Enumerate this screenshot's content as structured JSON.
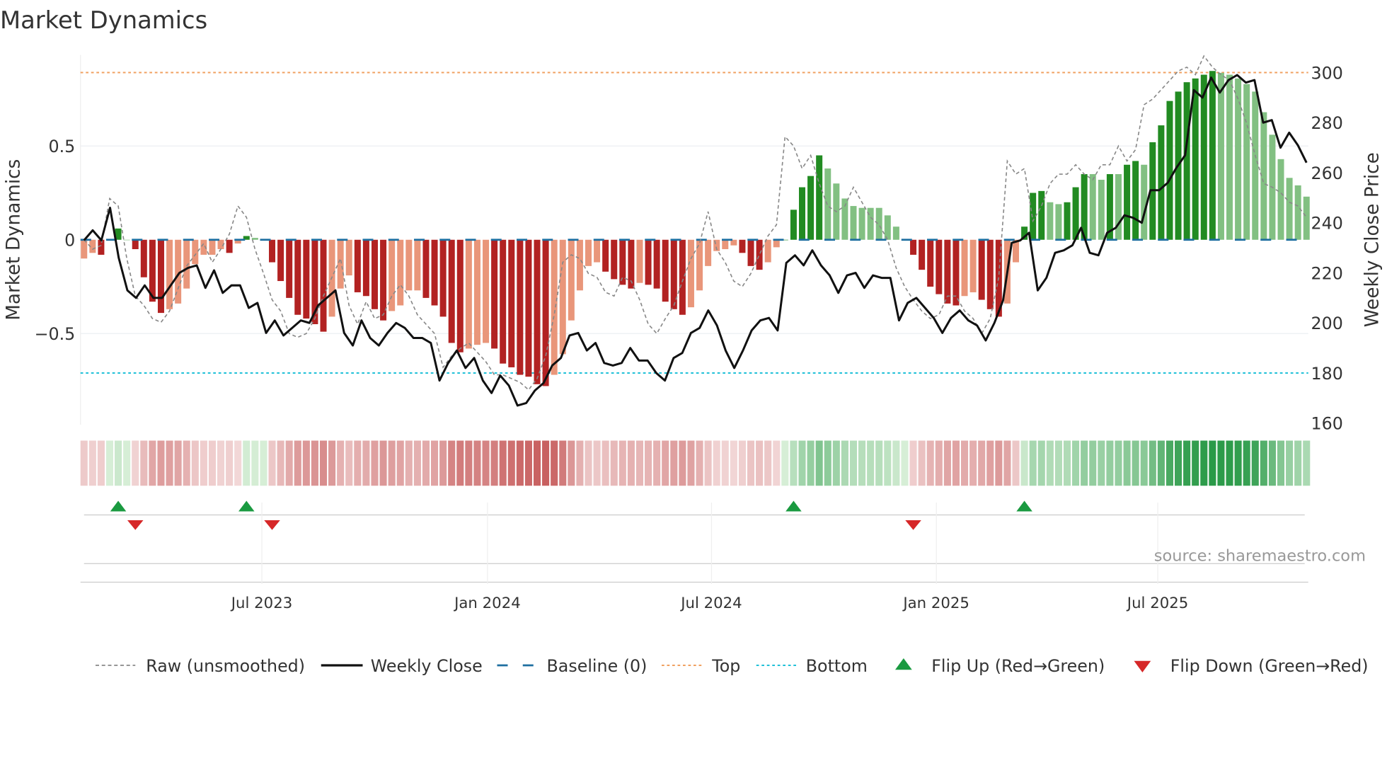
{
  "chart_data": {
    "type": "bar",
    "title": "Market Dynamics",
    "ylabel": "Market Dynamics",
    "ylabel_right": "Weekly Close Price",
    "ylim": [
      -1.0,
      0.97
    ],
    "ylim_right": [
      160,
      305
    ],
    "yticks": [
      {
        "v": 0.5,
        "label": "0.5"
      },
      {
        "v": 0,
        "label": "0"
      },
      {
        "v": -0.5,
        "label": "−0.5"
      }
    ],
    "yticks_right": [
      160,
      180,
      200,
      220,
      240,
      260,
      280,
      300
    ],
    "xticks": [
      {
        "week": 20.8,
        "label": "Jul 2023"
      },
      {
        "week": 47.2,
        "label": "Jan 2024"
      },
      {
        "week": 73.4,
        "label": "Jul 2024"
      },
      {
        "week": 99.7,
        "label": "Jan 2025"
      },
      {
        "week": 125.6,
        "label": "Jul 2025"
      }
    ],
    "top_level_price": 300,
    "bottom_level_price": 180,
    "baseline": 0,
    "smoothed": [
      -0.1,
      -0.07,
      -0.08,
      0,
      0.06,
      0,
      -0.05,
      -0.2,
      -0.33,
      -0.39,
      -0.37,
      -0.34,
      -0.26,
      -0.13,
      -0.08,
      -0.08,
      -0.05,
      -0.07,
      -0.02,
      0.02,
      0.01,
      0,
      -0.12,
      -0.22,
      -0.31,
      -0.4,
      -0.42,
      -0.45,
      -0.49,
      -0.41,
      -0.26,
      -0.19,
      -0.28,
      -0.3,
      -0.37,
      -0.43,
      -0.38,
      -0.35,
      -0.27,
      -0.27,
      -0.31,
      -0.35,
      -0.41,
      -0.55,
      -0.6,
      -0.58,
      -0.56,
      -0.55,
      -0.58,
      -0.66,
      -0.68,
      -0.72,
      -0.73,
      -0.77,
      -0.78,
      -0.72,
      -0.61,
      -0.43,
      -0.27,
      -0.14,
      -0.12,
      -0.17,
      -0.21,
      -0.24,
      -0.26,
      -0.23,
      -0.24,
      -0.26,
      -0.33,
      -0.37,
      -0.4,
      -0.36,
      -0.27,
      -0.14,
      -0.06,
      -0.05,
      -0.03,
      -0.07,
      -0.14,
      -0.16,
      -0.12,
      -0.04,
      0,
      0.16,
      0.28,
      0.34,
      0.45,
      0.38,
      0.3,
      0.22,
      0.18,
      0.17,
      0.17,
      0.17,
      0.13,
      0.07,
      0,
      -0.08,
      -0.16,
      -0.25,
      -0.29,
      -0.34,
      -0.35,
      -0.3,
      -0.28,
      -0.32,
      -0.37,
      -0.41,
      -0.34,
      -0.12,
      0.07,
      0.25,
      0.26,
      0.2,
      0.19,
      0.2,
      0.28,
      0.35,
      0.35,
      0.32,
      0.35,
      0.35,
      0.4,
      0.42,
      0.4,
      0.52,
      0.61,
      0.74,
      0.79,
      0.84,
      0.86,
      0.88,
      0.9,
      0.89,
      0.88,
      0.86,
      0.83,
      0.79,
      0.68,
      0.56,
      0.43,
      0.33,
      0.29,
      0.23
    ],
    "raw": [
      0,
      -0.05,
      -0.03,
      0.22,
      0.18,
      -0.1,
      -0.3,
      -0.35,
      -0.42,
      -0.44,
      -0.38,
      -0.26,
      -0.14,
      -0.08,
      -0.02,
      -0.12,
      -0.05,
      0.03,
      0.18,
      0.12,
      -0.05,
      -0.18,
      -0.32,
      -0.38,
      -0.5,
      -0.52,
      -0.5,
      -0.42,
      -0.3,
      -0.2,
      -0.1,
      -0.35,
      -0.45,
      -0.33,
      -0.42,
      -0.4,
      -0.3,
      -0.24,
      -0.3,
      -0.4,
      -0.45,
      -0.5,
      -0.68,
      -0.62,
      -0.58,
      -0.55,
      -0.6,
      -0.65,
      -0.72,
      -0.72,
      -0.74,
      -0.76,
      -0.8,
      -0.74,
      -0.62,
      -0.4,
      -0.12,
      -0.08,
      -0.1,
      -0.18,
      -0.2,
      -0.28,
      -0.3,
      -0.2,
      -0.22,
      -0.32,
      -0.45,
      -0.5,
      -0.42,
      -0.35,
      -0.22,
      -0.1,
      -0.02,
      0.15,
      -0.05,
      -0.12,
      -0.22,
      -0.25,
      -0.18,
      -0.08,
      0.02,
      0.08,
      0.55,
      0.5,
      0.38,
      0.45,
      0.3,
      0.18,
      0.15,
      0.18,
      0.28,
      0.2,
      0.12,
      0.08,
      0,
      -0.15,
      -0.25,
      -0.32,
      -0.38,
      -0.42,
      -0.4,
      -0.3,
      -0.3,
      -0.38,
      -0.42,
      -0.5,
      -0.42,
      -0.2,
      0.42,
      0.35,
      0.38,
      0.1,
      0.18,
      0.3,
      0.35,
      0.35,
      0.4,
      0.35,
      0.32,
      0.4,
      0.4,
      0.5,
      0.42,
      0.48,
      0.72,
      0.75,
      0.8,
      0.85,
      0.9,
      0.92,
      0.88,
      0.98,
      0.92,
      0.88,
      0.85,
      0.75,
      0.62,
      0.45,
      0.3,
      0.28,
      0.25,
      0.2,
      0.18,
      0.12
    ],
    "weekly_close": [
      233,
      237,
      233,
      246,
      226,
      213,
      210,
      215,
      210,
      210,
      215,
      220,
      222,
      223,
      214,
      221,
      212,
      215,
      215,
      206,
      208,
      196,
      201,
      195,
      198,
      201,
      200,
      207,
      210,
      213,
      196,
      191,
      201,
      194,
      191,
      196,
      200,
      198,
      194,
      194,
      192,
      177,
      184,
      189,
      182,
      186,
      177,
      172,
      179,
      175,
      167,
      168,
      173,
      176,
      183,
      186,
      195,
      196,
      189,
      192,
      184,
      183,
      184,
      190,
      185,
      185,
      180,
      177,
      186,
      188,
      196,
      198,
      205,
      199,
      189,
      182,
      189,
      197,
      201,
      202,
      197,
      224,
      227,
      223,
      229,
      223,
      219,
      212,
      219,
      220,
      214,
      219,
      218,
      218,
      201,
      208,
      210,
      206,
      202,
      196,
      202,
      205,
      201,
      199,
      193,
      200,
      209,
      232,
      233,
      236,
      213,
      218,
      228,
      229,
      231,
      238,
      228,
      227,
      236,
      238,
      243,
      242,
      240,
      253,
      253,
      256,
      262,
      267,
      293,
      290,
      298,
      292,
      297,
      299,
      296,
      297,
      280,
      281,
      270,
      276,
      271,
      264
    ],
    "flip_up_weeks": [
      4,
      19,
      83,
      110
    ],
    "flip_down_weeks": [
      6,
      22,
      97
    ],
    "colors": {
      "green_rising": "#228b22",
      "green_falling": "#82c082",
      "red_falling": "#b22222",
      "red_rising": "#e9967a",
      "close": "#111111",
      "raw": "#888888",
      "baseline": "#1f6fa0",
      "top": "#f0a060",
      "bottom": "#20c0d8",
      "flip_up": "#1a9a40",
      "flip_down": "#d62728"
    },
    "legend": [
      {
        "key": "raw",
        "label": "Raw (unsmoothed)"
      },
      {
        "key": "close",
        "label": "Weekly Close"
      },
      {
        "key": "baseline",
        "label": "Baseline (0)"
      },
      {
        "key": "top",
        "label": "Top"
      },
      {
        "key": "bottom",
        "label": "Bottom"
      },
      {
        "key": "flip_up",
        "label": "Flip Up (Red→Green)"
      },
      {
        "key": "flip_down",
        "label": "Flip Down (Green→Red)"
      }
    ],
    "legend_position": "bottom"
  },
  "source": "source: sharemaestro.com"
}
